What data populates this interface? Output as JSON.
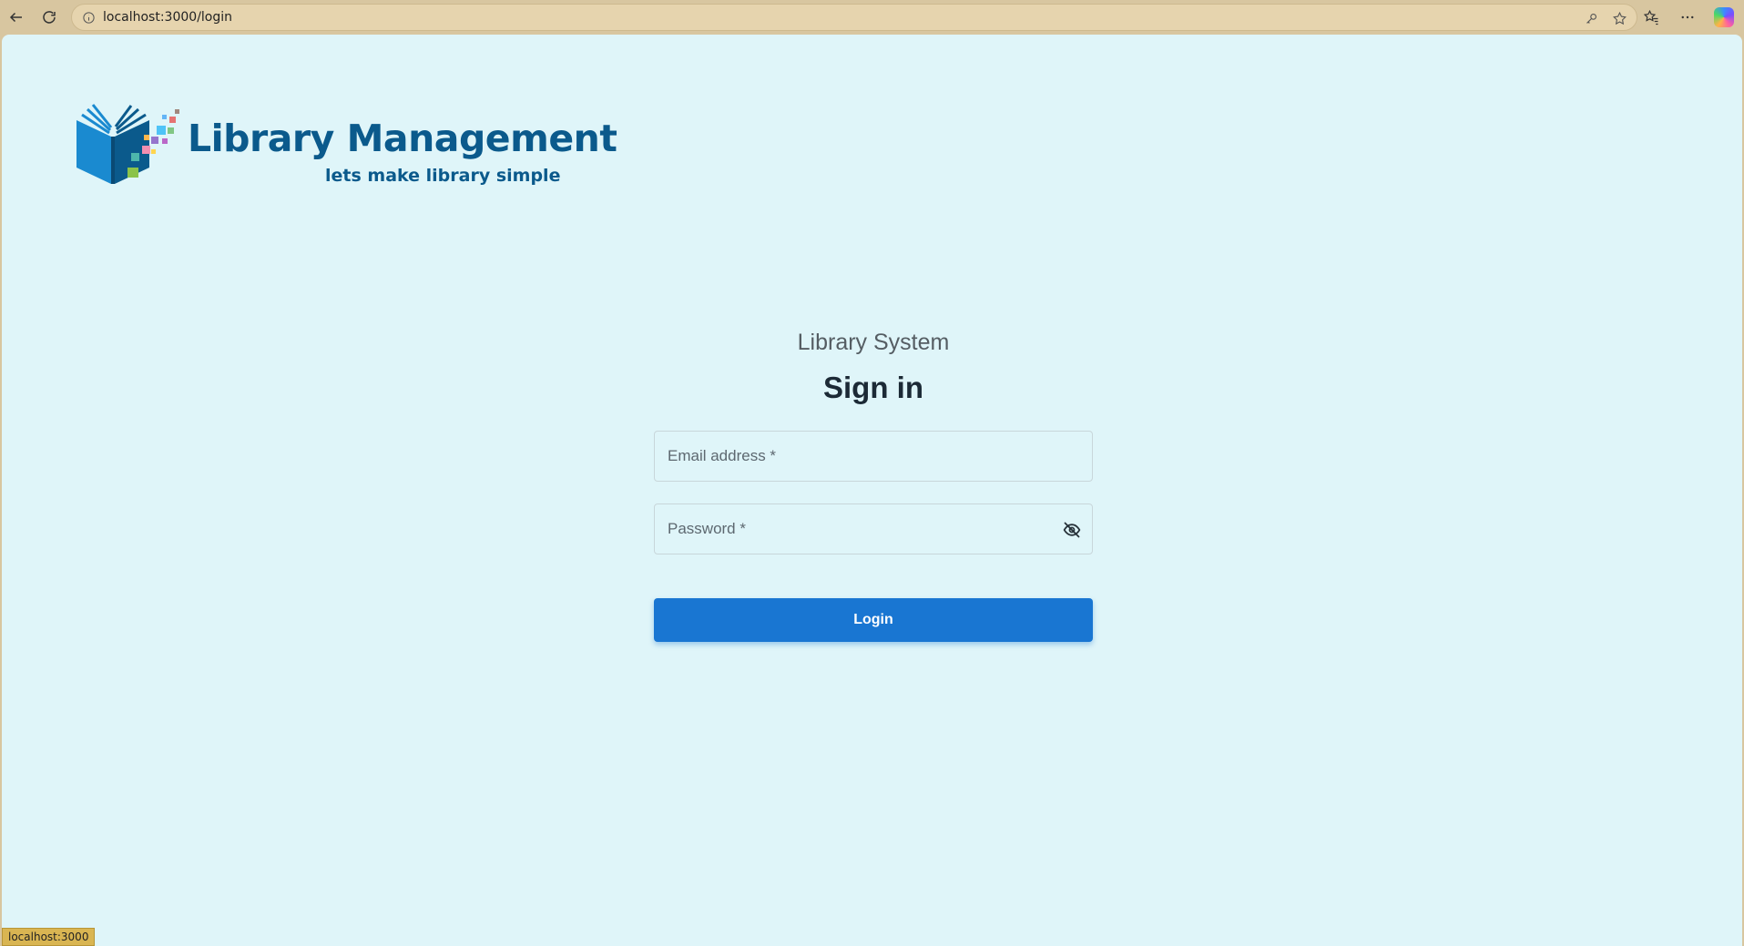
{
  "browser": {
    "url": "localhost:3000/login",
    "status_url": "localhost:3000"
  },
  "logo": {
    "title": "Library Management",
    "tagline": "lets make library simple"
  },
  "login": {
    "system_title": "Library System",
    "heading": "Sign in",
    "email_label": "Email address *",
    "password_label": "Password *",
    "login_label": "Login"
  },
  "colors": {
    "page_background": "#dff5f9",
    "primary": "#1976d2",
    "brand": "#0b5a8c"
  },
  "icons": {
    "back": "arrow-left-icon",
    "reload": "reload-icon",
    "site_info": "info-icon",
    "password_manager": "key-icon",
    "favorite": "star-icon",
    "favorites": "favorites-icon",
    "more": "more-icon",
    "copilot": "copilot-icon",
    "toggle_password": "eye-off-icon"
  }
}
